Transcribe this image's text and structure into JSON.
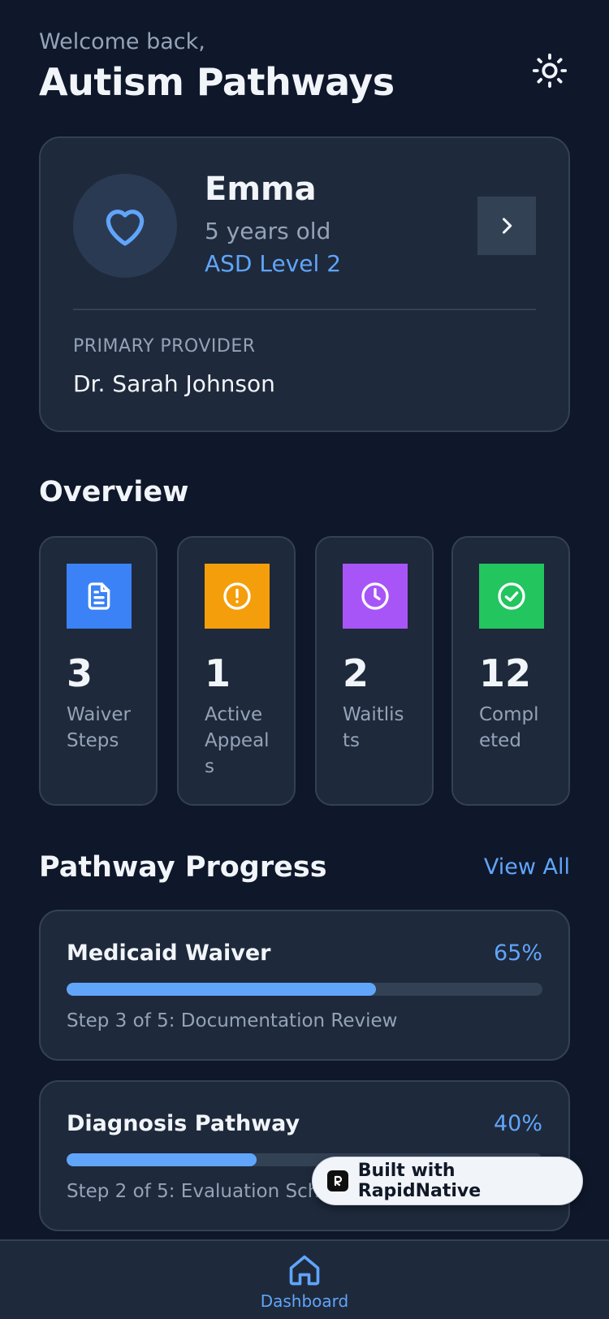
{
  "header": {
    "welcome": "Welcome back,",
    "title": "Autism Pathways",
    "theme_icon": "sun-icon"
  },
  "profile": {
    "name": "Emma",
    "age": "5 years old",
    "level": "ASD Level 2",
    "avatar_icon": "heart-icon",
    "provider_label": "PRIMARY PROVIDER",
    "provider_name": "Dr. Sarah Johnson"
  },
  "overview": {
    "title": "Overview",
    "stats": [
      {
        "value": "3",
        "label": "Waiver Steps",
        "icon": "document-icon",
        "color": "#3b82f6"
      },
      {
        "value": "1",
        "label": "Active Appeals",
        "icon": "alert-circle-icon",
        "color": "#f59e0b"
      },
      {
        "value": "2",
        "label": "Waitlists",
        "icon": "clock-icon",
        "color": "#a855f7"
      },
      {
        "value": "12",
        "label": "Completed",
        "icon": "check-circle-icon",
        "color": "#22c55e"
      }
    ]
  },
  "pathway": {
    "title": "Pathway Progress",
    "view_all": "View All",
    "items": [
      {
        "title": "Medicaid Waiver",
        "percent_label": "65%",
        "progress": 0.65,
        "step": "Step 3 of 5: Documentation Review"
      },
      {
        "title": "Diagnosis Pathway",
        "percent_label": "40%",
        "progress": 0.4,
        "step": "Step 2 of 5: Evaluation Scheduling"
      }
    ]
  },
  "badge": {
    "text": "Built with RapidNative"
  },
  "nav": {
    "dashboard": "Dashboard"
  },
  "colors": {
    "background": "#0f172a",
    "card": "#1e293b",
    "accent": "#60a5fa"
  }
}
